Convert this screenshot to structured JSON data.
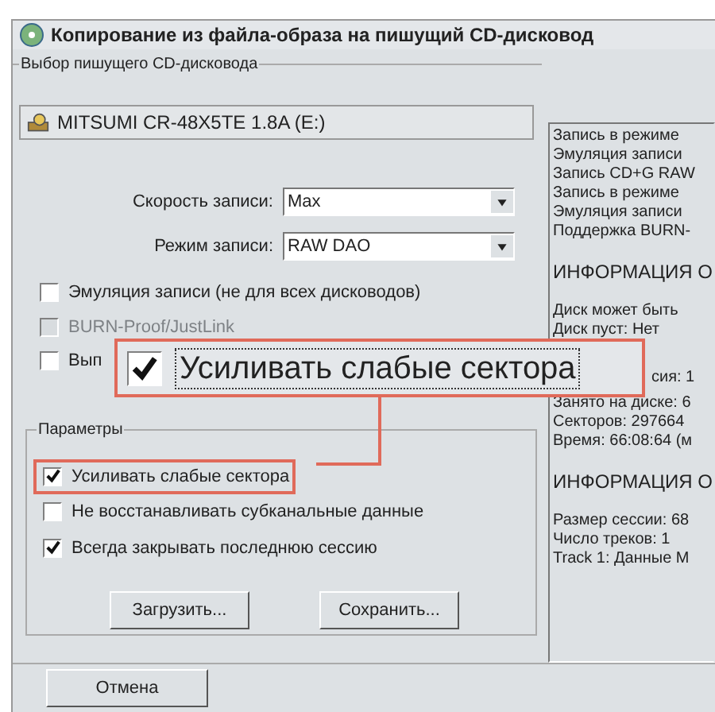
{
  "window": {
    "title": "Копирование из файла-образа на пишущий CD-дисковод"
  },
  "drive_group": {
    "label": "Выбор пишущего CD-дисковода",
    "drive": "MITSUMI CR-48X5TE 1.8A (E:)",
    "fields": [
      {
        "label": "Скорость записи:",
        "value": "Max"
      },
      {
        "label": "Режим записи:",
        "value": "RAW DAO"
      }
    ],
    "options": [
      {
        "label": "Эмуляция записи (не для всех дисководов)",
        "checked": false,
        "disabled": false
      },
      {
        "label": "BURN-Proof/JustLink",
        "checked": false,
        "disabled": true
      },
      {
        "label": "Вып",
        "checked": false,
        "disabled": false
      }
    ]
  },
  "params_group": {
    "label": "Параметры",
    "options": [
      {
        "label": "Усиливать слабые сектора",
        "checked": true,
        "highlighted": true
      },
      {
        "label": "Не восстанавливать субканальные данные",
        "checked": false,
        "highlighted": false
      },
      {
        "label": "Всегда закрывать последнюю сессию",
        "checked": true,
        "highlighted": false
      }
    ],
    "buttons": [
      "Загрузить...",
      "Сохранить..."
    ]
  },
  "info_panel": {
    "blocks": [
      {
        "kind": "text",
        "lines": [
          "Запись в режиме",
          "Эмуляция записи",
          "Запись CD+G RAW",
          "Запись в режиме",
          "Эмуляция записи",
          "Поддержка BURN-"
        ]
      },
      {
        "kind": "heading",
        "lines": [
          "ИНФОРМАЦИЯ О"
        ]
      },
      {
        "kind": "text",
        "lines": [
          "Диск может быть",
          "Диск пуст: Нет"
        ]
      },
      {
        "kind": "partial",
        "lines": [
          "сия: 1"
        ]
      },
      {
        "kind": "text",
        "lines": [
          "Занято на диске: 6",
          "Секторов: 297664",
          "Время: 66:08:64 (м"
        ]
      },
      {
        "kind": "heading",
        "lines": [
          "ИНФОРМАЦИЯ О"
        ]
      },
      {
        "kind": "text",
        "lines": [
          "Размер сессии: 68",
          "Число треков: 1",
          "Track 1: Данные M"
        ]
      }
    ]
  },
  "callout": {
    "label": "Усиливать слабые сектора",
    "checked": true
  },
  "cancel_button": "Отмена"
}
